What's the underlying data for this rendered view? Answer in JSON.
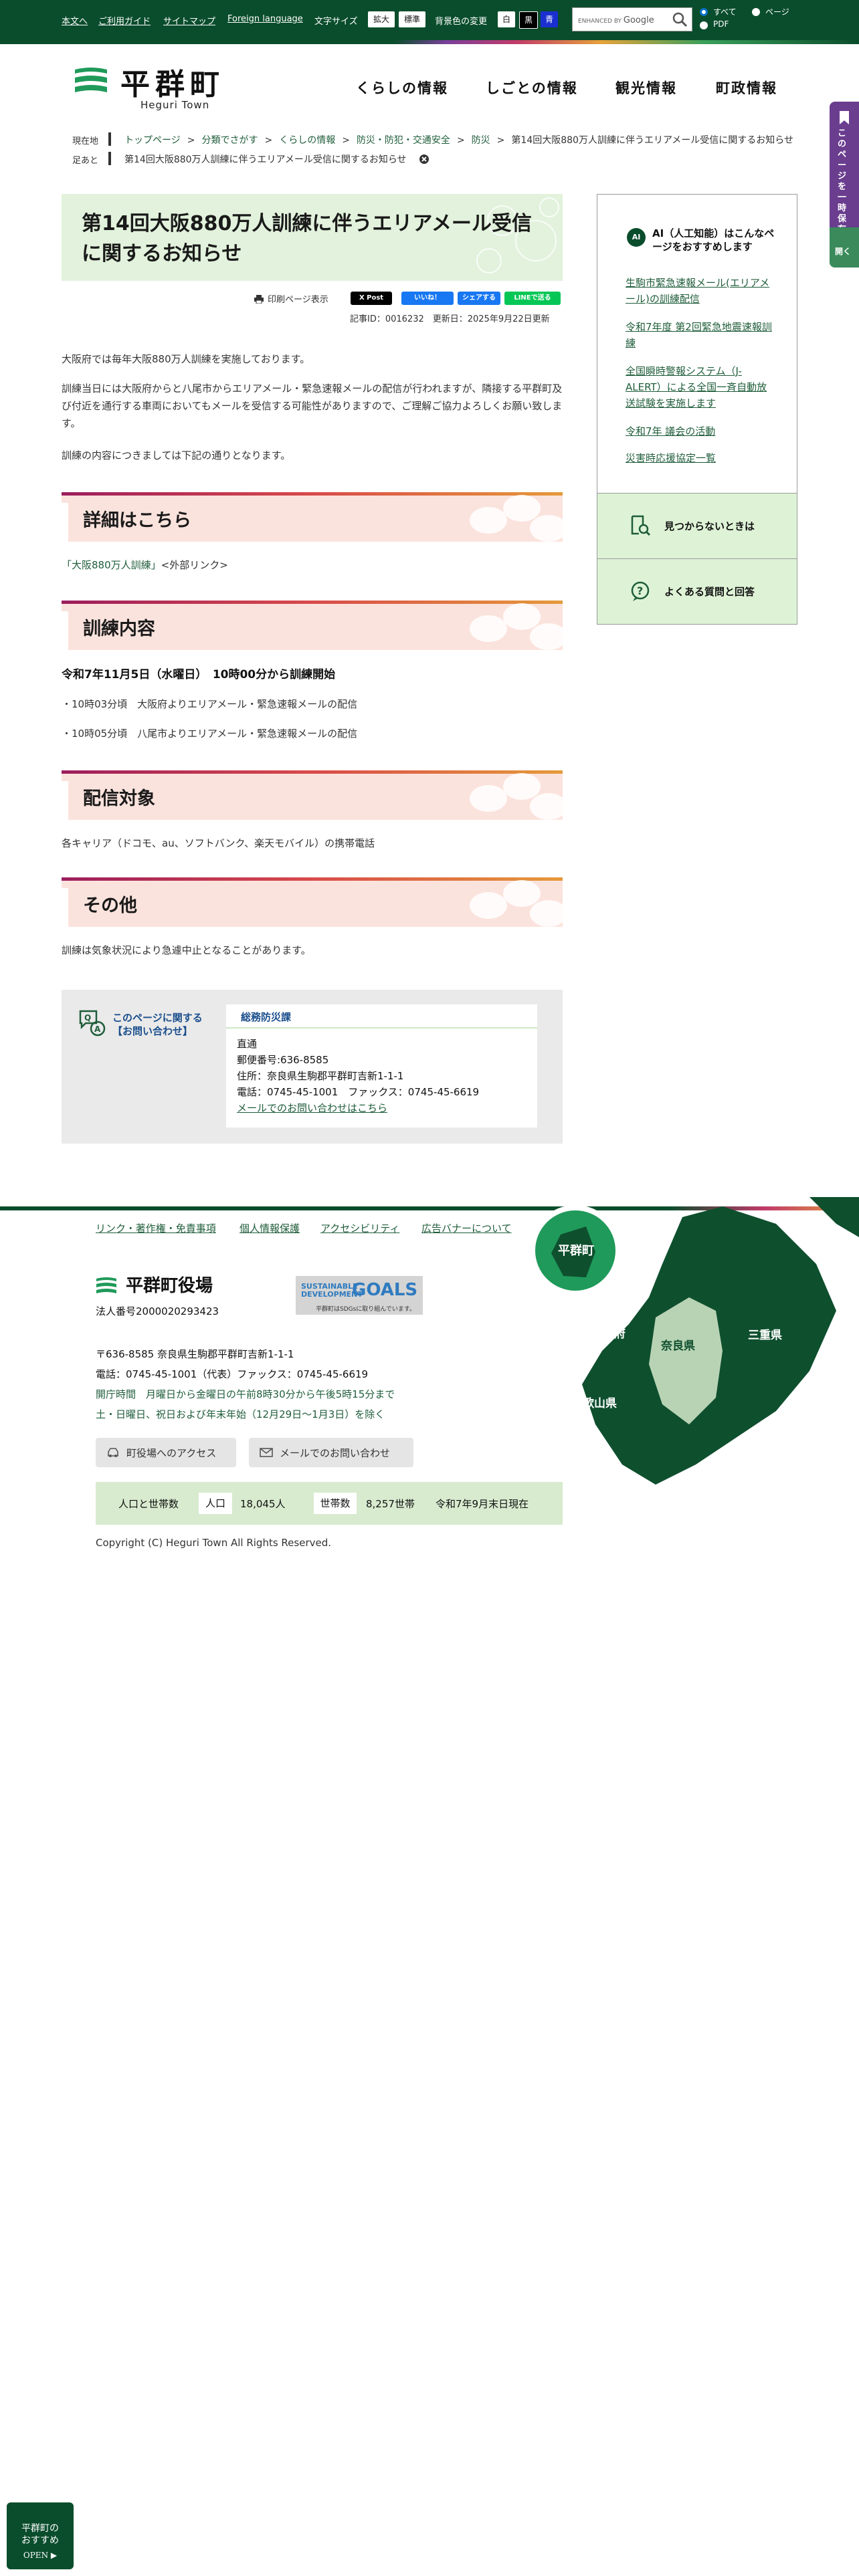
{
  "topbar": {
    "links": [
      "本文へ",
      "ご利用ガイド",
      "サイトマップ",
      "Foreign language"
    ],
    "font_size_label": "文字サイズ",
    "font_large": "拡大",
    "font_normal": "標準",
    "bg_label": "背景色の変更",
    "bg_white": "白",
    "bg_black": "黒",
    "bg_blue": "青",
    "search_enhanced": "ENHANCED BY",
    "search_google": "Google",
    "scope_all": "すべて",
    "scope_page": "ページ",
    "scope_pdf": "PDF"
  },
  "header": {
    "site_name": "平群町",
    "site_name_en": "Heguri Town",
    "nav": [
      "くらしの情報",
      "しごとの情報",
      "観光情報",
      "町政情報"
    ]
  },
  "side_tab": {
    "label": "このページを一時保存する",
    "close": "開く"
  },
  "breadcrumb": {
    "current_label": "現在地",
    "footprint_label": "足あと",
    "items": [
      "トップページ",
      "分類でさがす",
      "くらしの情報",
      "防災・防犯・交通安全",
      "防災"
    ],
    "current": "第14回大阪880万人訓練に伴うエリアメール受信に関するお知らせ",
    "footprint": "第14回大阪880万人訓練に伴うエリアメール受信に関するお知らせ"
  },
  "article": {
    "title": "第14回大阪880万人訓練に伴うエリアメール受信に関するお知らせ",
    "print": "印刷ページ表示",
    "share_x": "X Post",
    "share_like": "いいね！",
    "share_fb": "シェアする",
    "share_line": "LINEで送る",
    "meta": "記事ID：0016232　更新日：2025年9月22日更新",
    "intro": [
      "大阪府では毎年大阪880万人訓練を実施しております。",
      "訓練当日には大阪府からと八尾市からエリアメール・緊急速報メールの配信が行われますが、隣接する平群町及び付近を通行する車両においてもメールを受信する可能性がありますので、ご理解ご協力よろしくお願い致します。",
      "訓練の内容につきましては下記の通りとなります。"
    ],
    "sec_detail": "詳細はこちら",
    "detail_link": "「大阪880万人訓練」",
    "detail_link_suffix": "<外部リンク>",
    "sec_content": "訓練内容",
    "content_date": "令和7年11月5日（水曜日）　10時00分から訓練開始",
    "content_items": [
      "・10時03分頃　大阪府よりエリアメール・緊急速報メールの配信",
      "・10時05分頃　八尾市よりエリアメール・緊急速報メールの配信"
    ],
    "sec_target": "配信対象",
    "target_text": "各キャリア（ドコモ、au、ソフトバンク、楽天モバイル）の携帯電話",
    "sec_other": "その他",
    "other_text": "訓練は気象状況により急遽中止となることがあります。"
  },
  "contact": {
    "title": "このページに関する【お問い合わせ】",
    "title_line1": "このページに関する",
    "title_line2": "【お問い合わせ】",
    "dept": "総務防災課",
    "lines": [
      "直通",
      "郵便番号:636-8585",
      "住所：奈良県生駒郡平群町吉新1-1-1",
      "電話：0745-45-1001　ファックス：0745-45-6619"
    ],
    "mail": "メールでのお問い合わせはこちら"
  },
  "sidebar": {
    "ai_badge": "AI",
    "ai_title": "AI（人工知能）はこんなページをおすすめします",
    "links": [
      "生駒市緊急速報メール(エリアメール)の訓練配信",
      "令和7年度 第2回緊急地震速報訓練",
      "全国瞬時警報システム（J-ALERT）による全国一斉自動放送試験を実施します",
      "令和7年 議会の活動",
      "災害時応援協定一覧"
    ],
    "notfound": "見つからないときは",
    "faq": "よくある質問と回答"
  },
  "footer": {
    "links": [
      "リンク・著作権・免責事項",
      "個人情報保護",
      "アクセシビリティ",
      "広告バナーについて"
    ],
    "name": "平群町役場",
    "corp_no": "法人番号2000020293423",
    "sdgs_a": "SUSTAINABLE DEVELOPMENT",
    "sdgs_b": "GOALS",
    "sdgs_c": "平群町はSDGsに取り組んでいます。",
    "address": "〒636-8585 奈良県生駒郡平群町吉新1-1-1",
    "tel": "電話：0745-45-1001（代表）ファックス：0745-45-6619",
    "hours1": "開庁時間　月曜日から金曜日の午前8時30分から午後5時15分まで",
    "hours2": "土・日曜日、祝日および年末年始（12月29日～1月3日）を除く",
    "access": "町役場へのアクセス",
    "mail": "メールでのお問い合わせ",
    "stats_title": "人口と世帯数",
    "pop_label": "人口",
    "pop_value": "18,045人",
    "hh_label": "世帯数",
    "hh_value": "8,257世帯",
    "stats_date": "令和7年9月末日現在",
    "copyright": "Copyright (C) Heguri Town All Rights Reserved.",
    "map_labels": {
      "heguri": "平群町",
      "osaka": "大阪府",
      "nara": "奈良県",
      "mie": "三重県",
      "wakayama": "和歌山県"
    }
  },
  "recommend": {
    "line1": "平群町の",
    "line2": "おすすめ",
    "open": "OPEN ▶"
  },
  "colors": {
    "brand_green": "#0a4d2c",
    "link_green": "#1f5d3a",
    "heading_bg": "#fbe3dd",
    "title_bg": "#e2f2dc",
    "contact_blue": "#1a4e8c"
  }
}
